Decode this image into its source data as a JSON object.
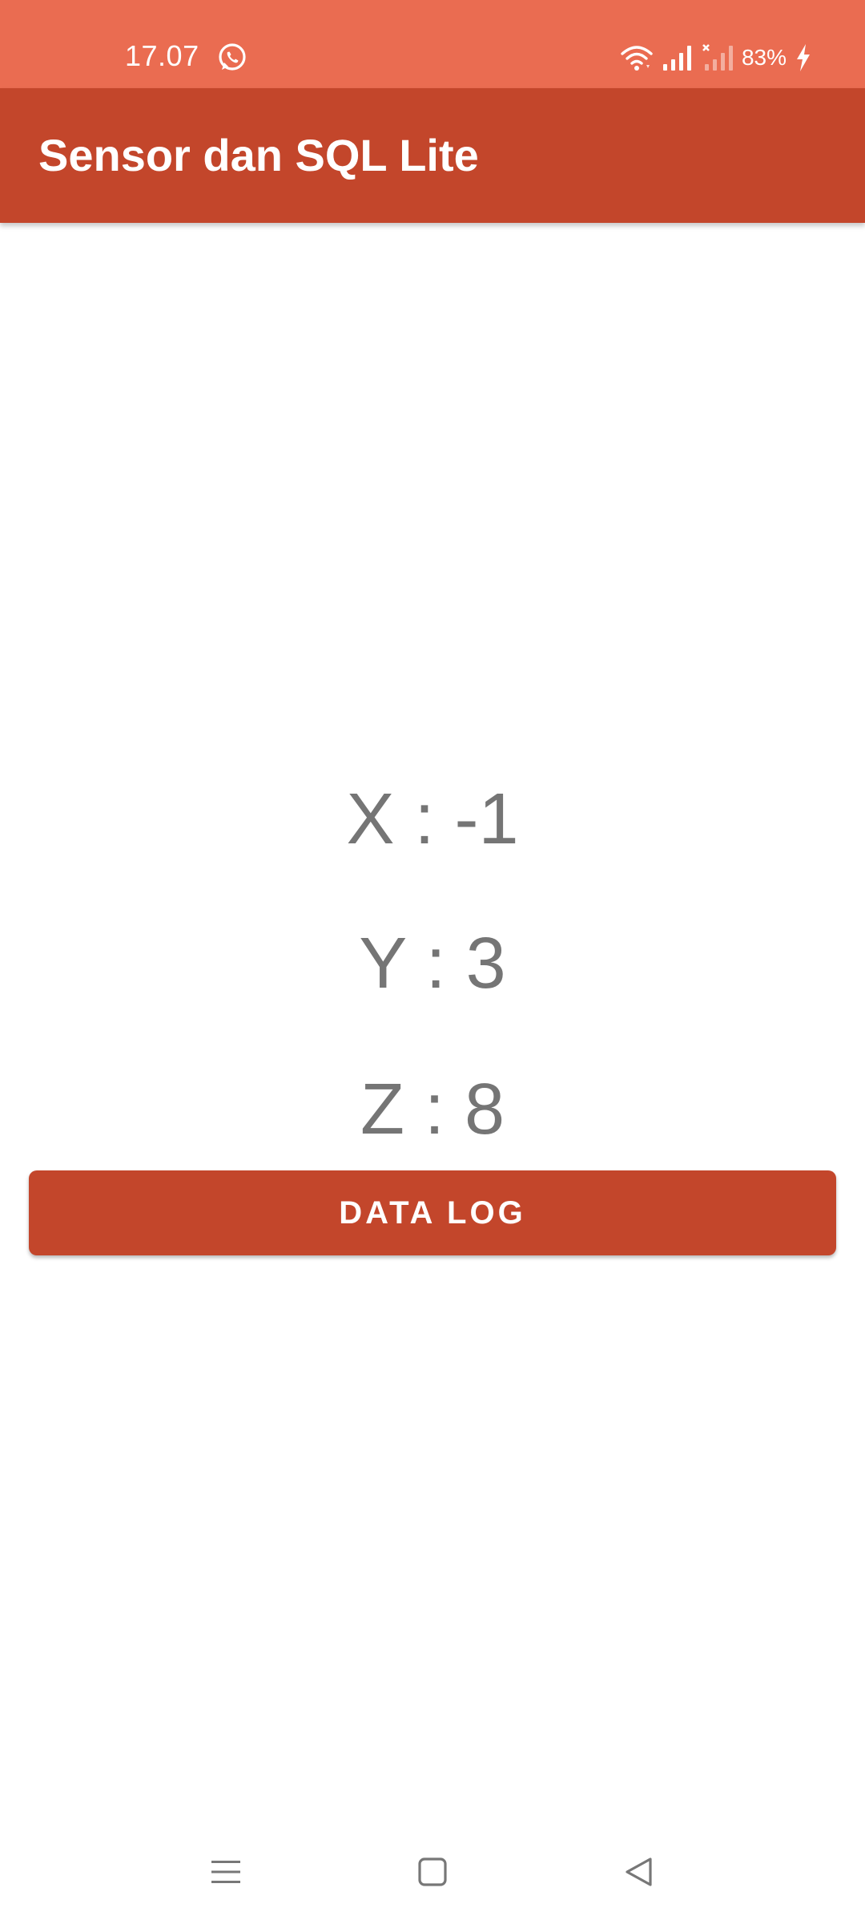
{
  "status_bar": {
    "time": "17.07",
    "battery": "83%",
    "icons": [
      "whatsapp-icon",
      "wifi-icon",
      "signal-icon",
      "no-signal-icon",
      "charging-icon"
    ],
    "background_color": "#ea6c51"
  },
  "app_bar": {
    "title": "Sensor dan SQL Lite",
    "background_color": "#c3462b"
  },
  "sensor": {
    "x_text": "X : -1",
    "y_text": "Y : 3",
    "z_text": "Z : 8"
  },
  "button": {
    "label": "DATA LOG",
    "color": "#c3462b"
  },
  "nav_bar": {
    "icons": [
      "menu-icon",
      "home-icon",
      "back-icon"
    ]
  }
}
